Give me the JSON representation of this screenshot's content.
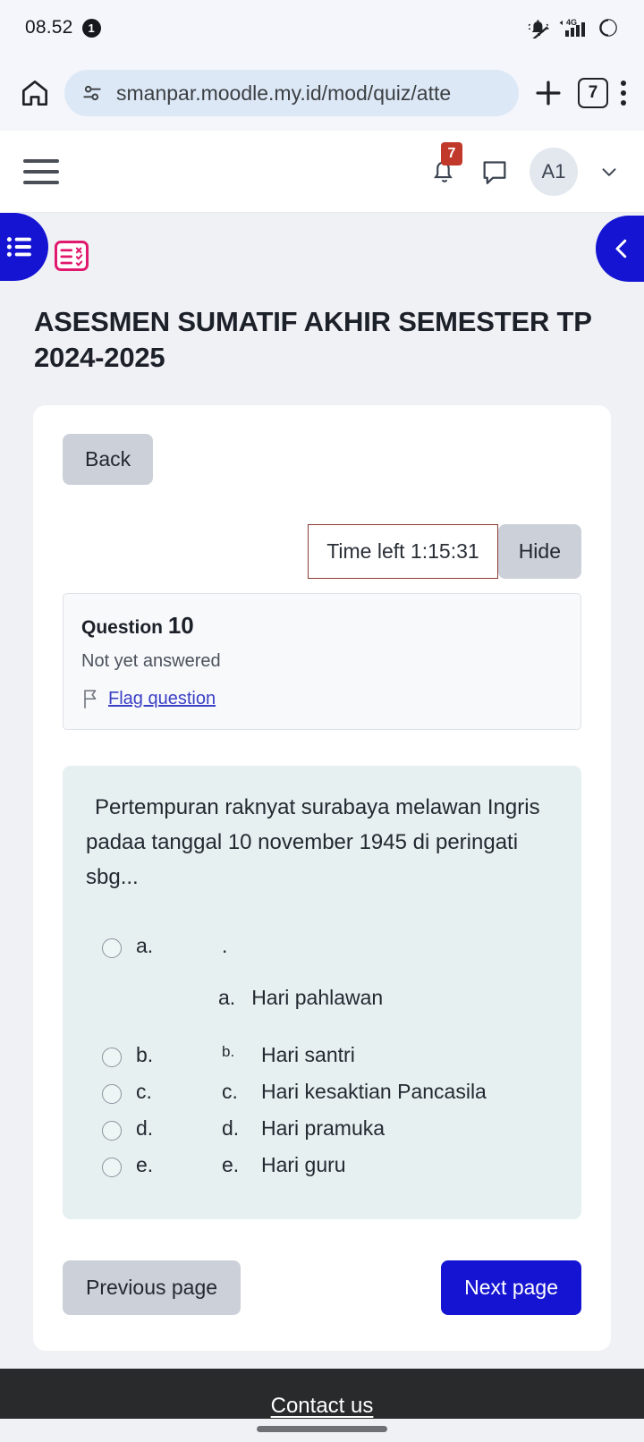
{
  "status_bar": {
    "time": "08.52",
    "notification_count": "1",
    "network": "4G",
    "icons": [
      "bell-muted-icon",
      "signal-4g-icon",
      "battery-icon"
    ]
  },
  "browser": {
    "home_icon": "home-icon",
    "site_settings_icon": "tune-icon",
    "url": "smanpar.moodle.my.id/mod/quiz/atte",
    "new_tab_icon": "plus-icon",
    "tab_count": "7",
    "menu_icon": "kebab-menu-icon"
  },
  "moodle_nav": {
    "menu_icon": "hamburger-icon",
    "notifications_icon": "bell-icon",
    "notifications_badge": "7",
    "messages_icon": "message-icon",
    "avatar_initials": "A1",
    "chevron_icon": "chevron-down-icon"
  },
  "drawers": {
    "left_icon": "list-icon",
    "quiz_nav_icon": "quiz-checklist-icon",
    "right_icon": "chevron-left-icon",
    "accent": "#1414d2",
    "quiz_icon_accent": "#e0196e"
  },
  "page": {
    "title": "ASESMEN SUMATIF AKHIR SEMESTER TP 2024-2025"
  },
  "quiz": {
    "back_label": "Back",
    "time_left_label": "Time left 1:15:31",
    "hide_label": "Hide",
    "timer_border_color": "#8b3b31",
    "question_number_prefix": "Question ",
    "question_number": "10",
    "state": "Not yet answered",
    "flag_icon": "flag-icon",
    "flag_label": "Flag question",
    "question_text": "Pertempuran raknyat surabaya  melawan Ingris padaa tanggal 10 november 1945 di peringati sbg...",
    "option_a_extra": ".",
    "option_a_detail_marker": "a.",
    "option_a_detail_text": "Hari pahlawan",
    "options": [
      {
        "label": "a.",
        "marker": "",
        "text": ".",
        "marker_small": false
      },
      {
        "label": "b.",
        "marker": "b.",
        "text": "Hari santri",
        "marker_small": true
      },
      {
        "label": "c.",
        "marker": "c.",
        "text": "Hari kesaktian Pancasila",
        "marker_small": false
      },
      {
        "label": "d.",
        "marker": "d.",
        "text": "Hari pramuka",
        "marker_small": false
      },
      {
        "label": "e.",
        "marker": "e.",
        "text": "Hari guru",
        "marker_small": false
      }
    ],
    "previous_page_label": "Previous page",
    "next_page_label": "Next page",
    "next_page_color": "#1414d2"
  },
  "footer": {
    "contact_label": "Contact us"
  }
}
